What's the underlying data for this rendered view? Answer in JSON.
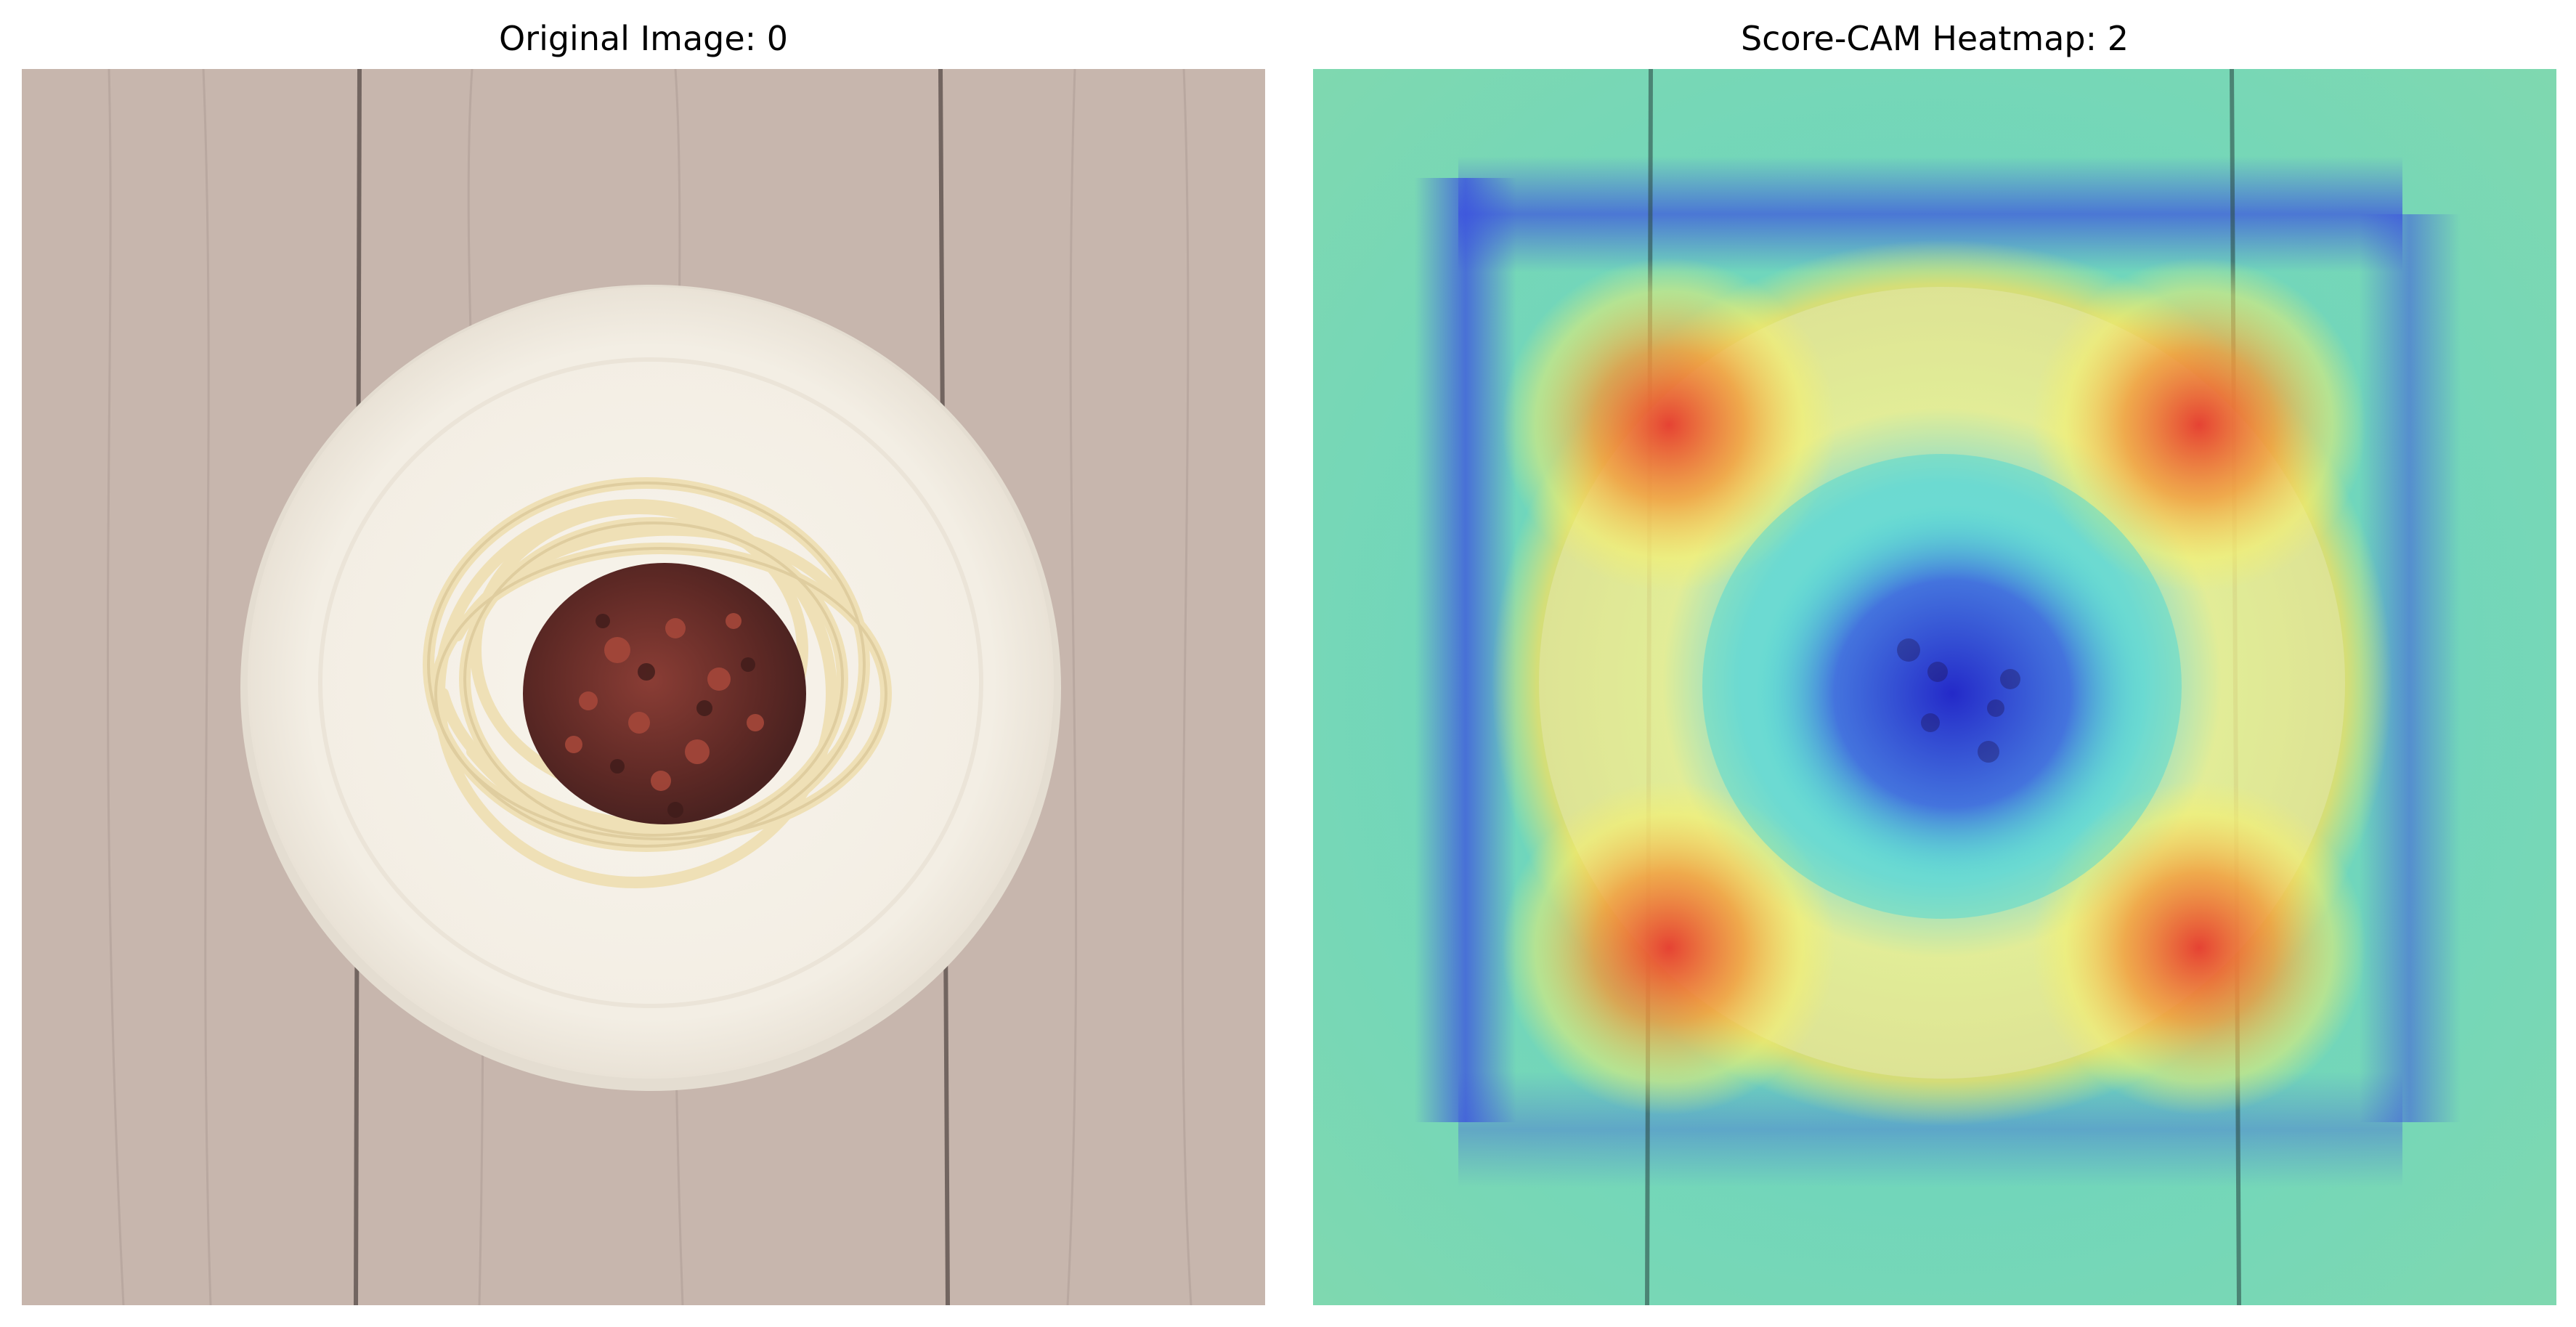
{
  "figure": {
    "left_panel": {
      "title": "Original Image: 0",
      "subject": "plate of spaghetti with meat sauce on wooden table"
    },
    "right_panel": {
      "title": "Score-CAM Heatmap: 2",
      "overlay": "jet colormap attention heatmap"
    }
  },
  "colors": {
    "wood": "#c7b6ad",
    "wood_dark": "#8a7a74",
    "plate": "#f6f2ea",
    "noodle": "#efe0b8",
    "sauce": "#6b2f2a",
    "heat_blue": "#2b2bdc",
    "heat_cyan": "#48d8d8",
    "heat_yellow": "#f7f06a",
    "heat_red": "#e63a2e"
  }
}
